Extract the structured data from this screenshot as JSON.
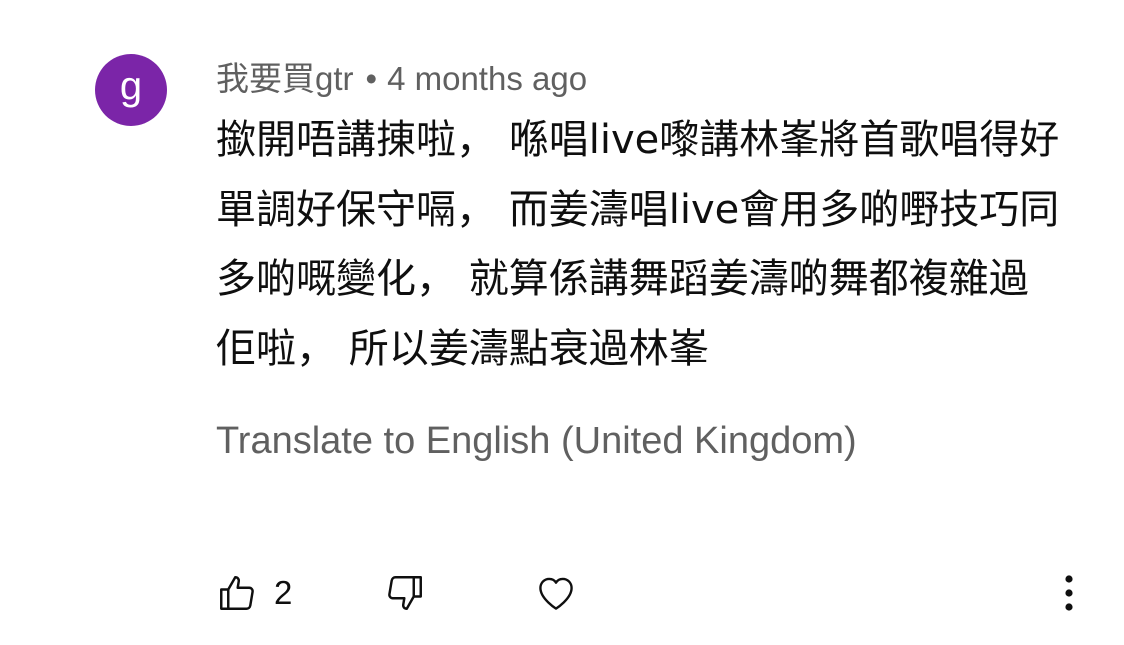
{
  "comment": {
    "avatar_letter": "g",
    "avatar_color": "#7b25a8",
    "author": "我要買gtr",
    "separator": "•",
    "time": "4 months ago",
    "body_lines": [
      "撳開唔講㨂啦，  喺唱live嚟講林峯將首歌唱得好",
      "單調好保守嗝，  而姜濤唱live會用多啲嘢技巧同",
      "多啲嘅變化，  就算係講舞蹈姜濤啲舞都複雜過",
      "佢啦，  所以姜濤點衰過林峯"
    ],
    "translate_label": "Translate to English (United Kingdom)"
  },
  "actions": {
    "like_icon": "thumb-up-icon",
    "like_count": "2",
    "dislike_icon": "thumb-down-icon",
    "heart_icon": "heart-icon",
    "more_icon": "more-vertical-icon"
  }
}
